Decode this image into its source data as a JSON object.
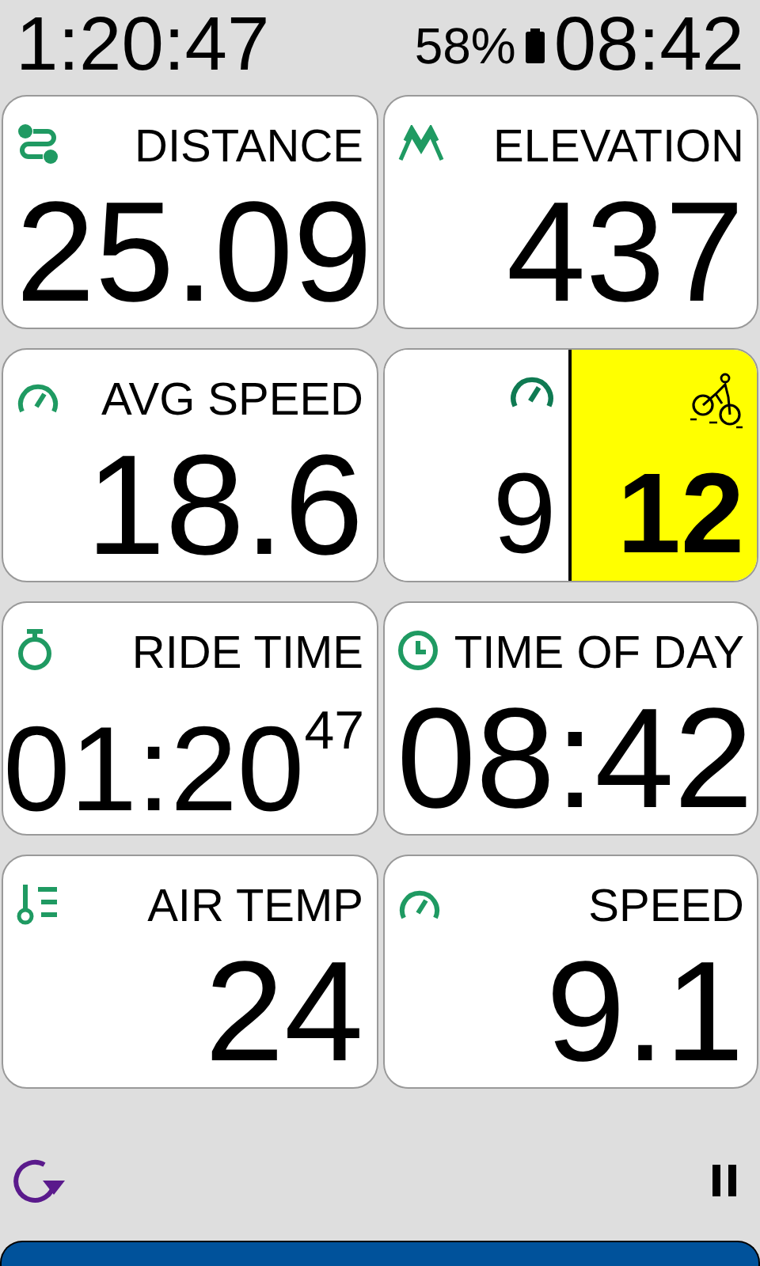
{
  "status_bar": {
    "timer": "1:20:47",
    "battery": "58%",
    "clock": "08:42"
  },
  "fields": [
    {
      "kind": "metric",
      "label": "DISTANCE",
      "value": "25.09"
    },
    {
      "kind": "metric",
      "label": "ELEVATION",
      "value": "437"
    },
    {
      "kind": "metric",
      "label": "AVG SPEED",
      "value": "18.6"
    },
    {
      "kind": "split",
      "segments": [
        {
          "value": "9",
          "highlighted": false
        },
        {
          "value": "12",
          "highlighted": true
        }
      ]
    },
    {
      "kind": "time",
      "label": "RIDE TIME",
      "value": "01:20$^{47}$"
    },
    {
      "kind": "metric",
      "label": "TIME OF DAY",
      "value": "08:42"
    },
    {
      "kind": "metric",
      "label": "AIR TEMP",
      "value": "24"
    },
    {
      "kind": "metric",
      "label": "SPEED",
      "value": "9.1"
    }
  ]
}
